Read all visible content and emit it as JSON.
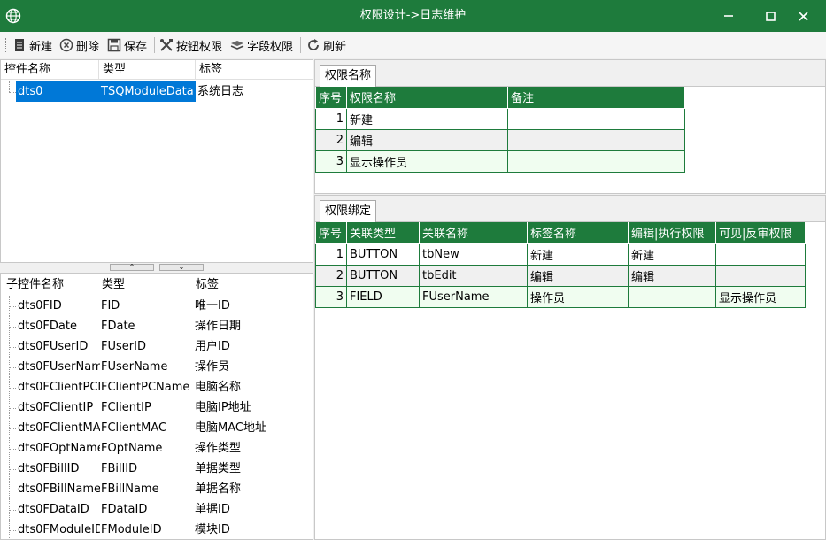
{
  "window": {
    "title": "权限设计->日志维护"
  },
  "toolbar": {
    "new_label": "新建",
    "delete_label": "删除",
    "save_label": "保存",
    "button_perm_label": "按钮权限",
    "field_perm_label": "字段权限",
    "refresh_label": "刷新"
  },
  "control_tree": {
    "headers": [
      "控件名称",
      "类型",
      "标签"
    ],
    "rows": [
      {
        "name": "dts0",
        "type": "TSQModuleData",
        "label": "系统日志"
      }
    ]
  },
  "child_controls": {
    "headers": [
      "子控件名称",
      "类型",
      "标签"
    ],
    "rows": [
      {
        "name": "dts0FID",
        "type": "FID",
        "label": "唯一ID"
      },
      {
        "name": "dts0FDate",
        "type": "FDate",
        "label": "操作日期"
      },
      {
        "name": "dts0FUserID",
        "type": "FUserID",
        "label": "用户ID"
      },
      {
        "name": "dts0FUserNam",
        "type": "FUserName",
        "label": "操作员"
      },
      {
        "name": "dts0FClientPCN",
        "type": "FClientPCName",
        "label": "电脑名称"
      },
      {
        "name": "dts0FClientIP",
        "type": "FClientIP",
        "label": "电脑IP地址"
      },
      {
        "name": "dts0FClientMA",
        "type": "FClientMAC",
        "label": "电脑MAC地址"
      },
      {
        "name": "dts0FOptName",
        "type": "FOptName",
        "label": "操作类型"
      },
      {
        "name": "dts0FBillID",
        "type": "FBillID",
        "label": "单据类型"
      },
      {
        "name": "dts0FBillName",
        "type": "FBillName",
        "label": "单据名称"
      },
      {
        "name": "dts0FDataID",
        "type": "FDataID",
        "label": "单据ID"
      },
      {
        "name": "dts0FModuleID",
        "type": "FModuleID",
        "label": "模块ID"
      }
    ]
  },
  "perm_names": {
    "tab_label": "权限名称",
    "headers": [
      "序号",
      "权限名称",
      "备注"
    ],
    "rows": [
      {
        "no": "1",
        "name": "新建",
        "remark": ""
      },
      {
        "no": "2",
        "name": "编辑",
        "remark": ""
      },
      {
        "no": "3",
        "name": "显示操作员",
        "remark": ""
      }
    ]
  },
  "perm_bind": {
    "tab_label": "权限绑定",
    "headers": [
      "序号",
      "关联类型",
      "关联名称",
      "标签名称",
      "编辑|执行权限",
      "可见|反审权限"
    ],
    "rows": [
      {
        "no": "1",
        "type": "BUTTON",
        "name": "tbNew",
        "tag": "新建",
        "edit": "新建",
        "visible": ""
      },
      {
        "no": "2",
        "type": "BUTTON",
        "name": "tbEdit",
        "tag": "编辑",
        "edit": "编辑",
        "visible": ""
      },
      {
        "no": "3",
        "type": "FIELD",
        "name": "FUserName",
        "tag": "操作员",
        "edit": "",
        "visible": "显示操作员"
      }
    ]
  },
  "colors": {
    "accent": "#1e7b3c",
    "selection": "#0078d7"
  }
}
